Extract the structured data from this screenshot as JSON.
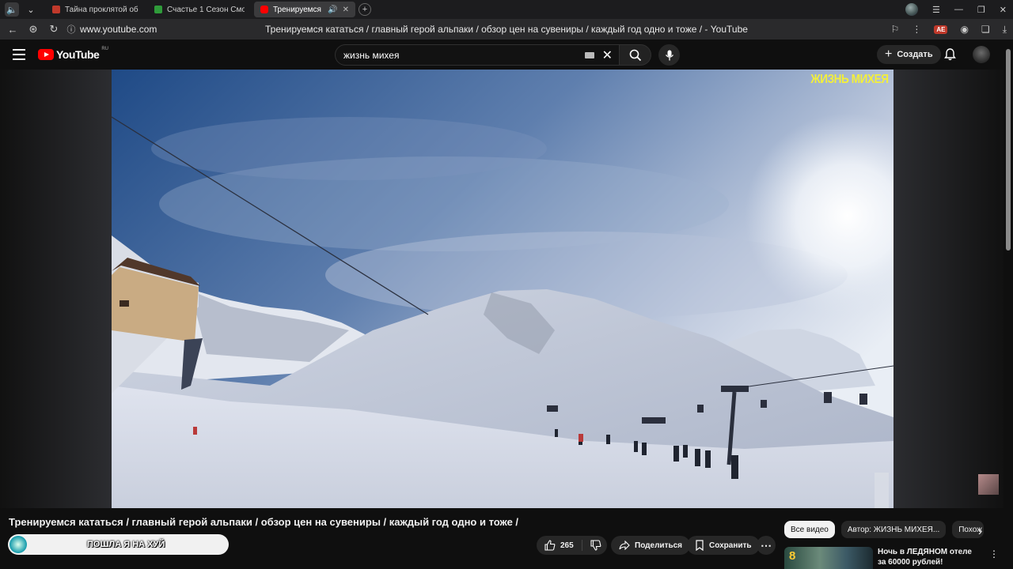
{
  "browser": {
    "tabs": [
      {
        "title": "Тайна проклятой обител",
        "favicon_color": "#c0392b"
      },
      {
        "title": "Счастье 1 Сезон Смотре",
        "favicon_color": "#2f9b3a"
      },
      {
        "title": "Тренируемся катат",
        "favicon_color": "#ff0000",
        "active": true,
        "audio": true
      }
    ],
    "url": "www.youtube.com",
    "page_title": "Тренируемся кататься / главный герой альпаки / обзор цен на сувениры / каждый год одно и тоже / - YouTube",
    "extension_badge": "AE"
  },
  "youtube": {
    "logo_text": "YouTube",
    "region": "RU",
    "search_value": "жизнь михея",
    "create_label": "Создать"
  },
  "video": {
    "watermark": "ЖИЗНЬ МИХЕЯ",
    "title": "Тренируемся кататься / главный герой альпаки / обзор цен на сувениры / каждый год одно и тоже /",
    "overlay_text": "ПОШЛА Я НА ХУЙ",
    "likes": "265",
    "share_label": "Поделиться",
    "save_label": "Сохранить"
  },
  "sidebar": {
    "chips": [
      "Все видео",
      "Автор: ЖИЗНЬ МИХЕЯ...",
      "Похож"
    ],
    "recommendation": {
      "thumb_number": "8",
      "title": "Ночь в ЛЕДЯНОМ отеле за 60000 рублей!"
    }
  },
  "colors": {
    "background": "#0f0f0f",
    "accent": "#ff0000",
    "watermark": "#f3ef3a"
  }
}
